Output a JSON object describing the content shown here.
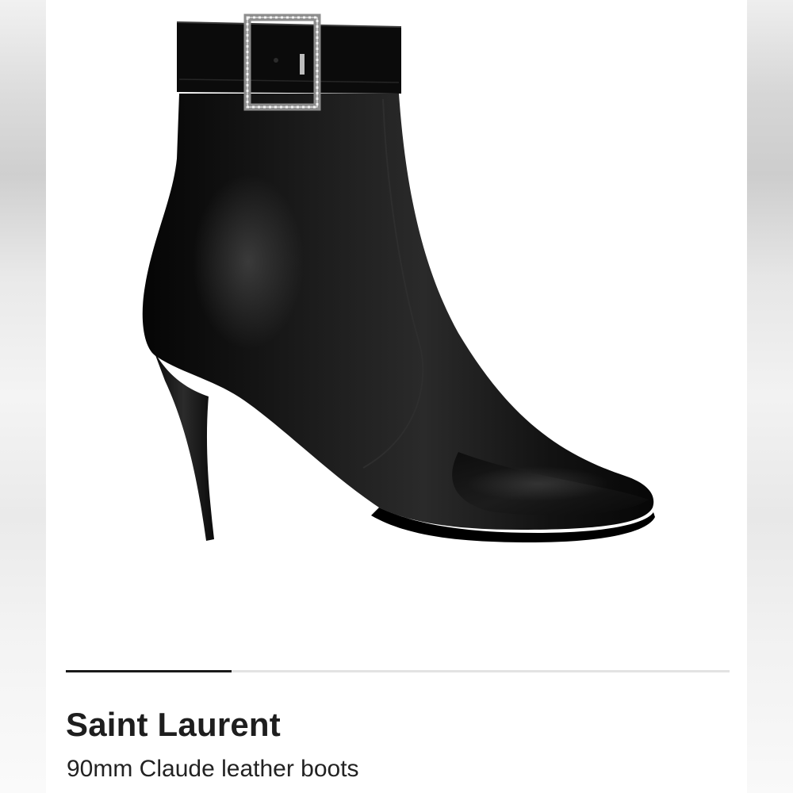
{
  "product": {
    "brand": "Saint Laurent",
    "name": "90mm Claude leather boots",
    "image_subject": "boot-image"
  },
  "carousel": {
    "progress": 0.25
  },
  "colors": {
    "brand_text": "#1e1e1e",
    "leather": "#0c0c0c",
    "track": "#e3e3e3",
    "progress": "#1a1a1a"
  }
}
